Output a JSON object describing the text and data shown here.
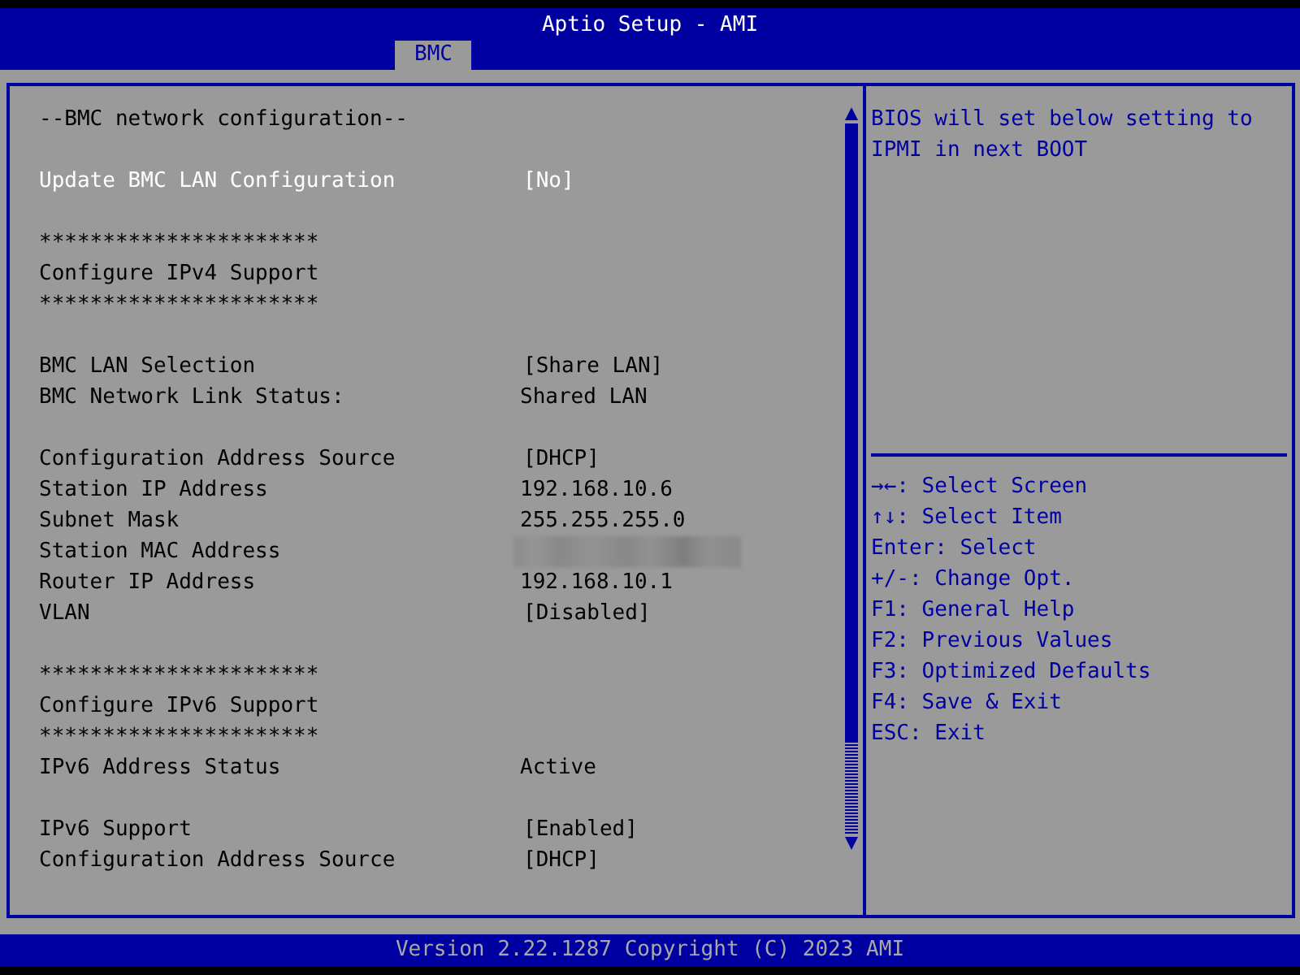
{
  "window": {
    "title": "Aptio Setup - AMI"
  },
  "tabs": [
    {
      "label": "BMC",
      "selected": true
    }
  ],
  "settings": {
    "sections": [
      [
        {
          "kind": "heading",
          "label": "--BMC network configuration--"
        }
      ],
      [
        {
          "kind": "option",
          "label": "Update BMC LAN Configuration",
          "value": "[No]",
          "selected": true
        }
      ],
      [
        {
          "kind": "text",
          "label": "**********************"
        },
        {
          "kind": "text",
          "label": "Configure IPv4 Support"
        },
        {
          "kind": "text",
          "label": "**********************"
        }
      ],
      [
        {
          "kind": "option",
          "label": "BMC LAN Selection",
          "value": "[Share LAN]",
          "selected": false
        },
        {
          "kind": "info",
          "label": "BMC Network Link Status:",
          "value": "Shared LAN"
        }
      ],
      [
        {
          "kind": "option",
          "label": "Configuration Address Source",
          "value": "[DHCP]",
          "selected": false
        },
        {
          "kind": "info",
          "label": "Station IP Address",
          "value": "192.168.10.6"
        },
        {
          "kind": "info",
          "label": "Subnet Mask",
          "value": "255.255.255.0"
        },
        {
          "kind": "redacted",
          "label": "Station MAC Address"
        },
        {
          "kind": "info",
          "label": "Router IP Address",
          "value": "192.168.10.1"
        },
        {
          "kind": "option",
          "label": "VLAN",
          "value": "[Disabled]",
          "selected": false
        }
      ],
      [
        {
          "kind": "text",
          "label": "**********************"
        },
        {
          "kind": "text",
          "label": "Configure IPv6 Support"
        },
        {
          "kind": "text",
          "label": "**********************"
        },
        {
          "kind": "info",
          "label": "IPv6 Address Status",
          "value": "Active"
        }
      ],
      [
        {
          "kind": "option",
          "label": "IPv6 Support",
          "value": "[Enabled]",
          "selected": false
        },
        {
          "kind": "option",
          "label": "Configuration Address Source",
          "value": "[DHCP]",
          "selected": false
        }
      ]
    ]
  },
  "help": {
    "description": "BIOS will set below setting to IPMI in next BOOT",
    "keys": [
      "→←: Select Screen",
      "↑↓: Select Item",
      "Enter: Select",
      "+/-: Change Opt.",
      "F1: General Help",
      "F2: Previous Values",
      "F3: Optimized Defaults",
      "F4: Save & Exit",
      "ESC: Exit"
    ]
  },
  "status_bar": {
    "text": "Version 2.22.1287 Copyright (C) 2023 AMI"
  }
}
